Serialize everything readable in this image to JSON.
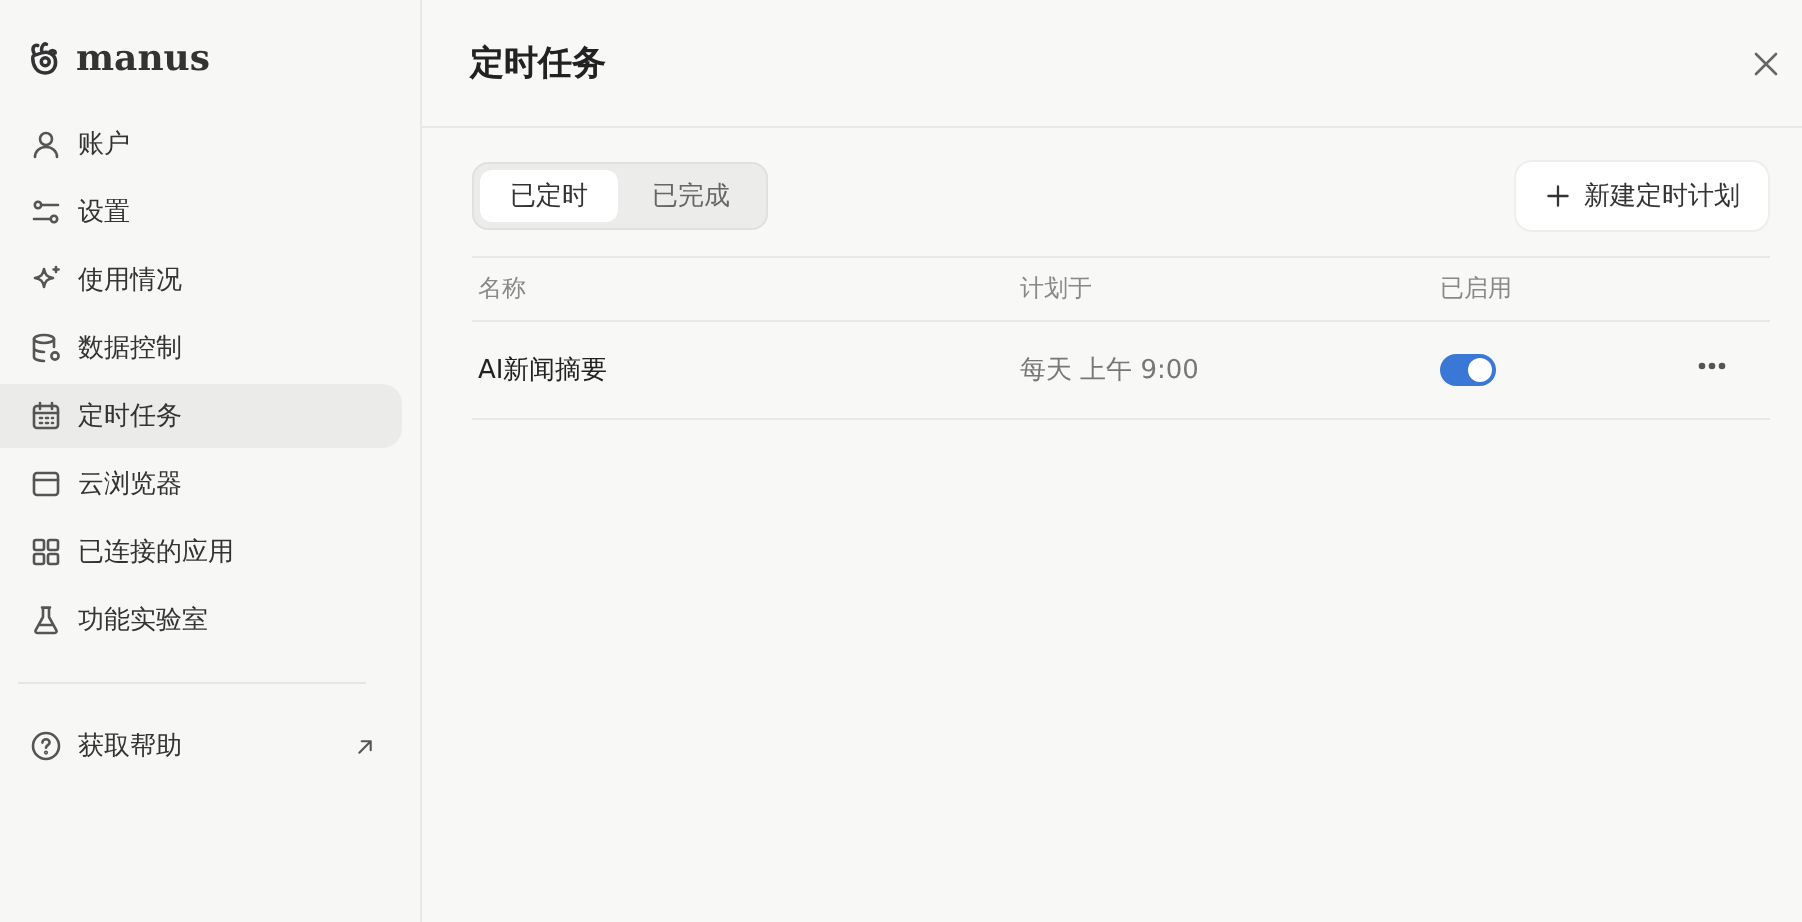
{
  "sidebar": {
    "logo": "manus",
    "items": [
      {
        "label": "账户",
        "selected": false
      },
      {
        "label": "设置",
        "selected": false
      },
      {
        "label": "使用情况",
        "selected": false
      },
      {
        "label": "数据控制",
        "selected": false
      },
      {
        "label": "定时任务",
        "selected": true
      },
      {
        "label": "云浏览器",
        "selected": false
      },
      {
        "label": "已连接的应用",
        "selected": false
      },
      {
        "label": "功能实验室",
        "selected": false
      }
    ],
    "help": {
      "label": "获取帮助"
    }
  },
  "main": {
    "title": "定时任务",
    "tabs": [
      {
        "label": "已定时",
        "selected": true
      },
      {
        "label": "已完成",
        "selected": false
      }
    ],
    "new_button": "新建定时计划",
    "table": {
      "columns": [
        "名称",
        "计划于",
        "已启用"
      ],
      "rows": [
        {
          "name": "AI新闻摘要",
          "schedule": "每天 上午 9:00",
          "enabled": true
        }
      ]
    }
  }
}
